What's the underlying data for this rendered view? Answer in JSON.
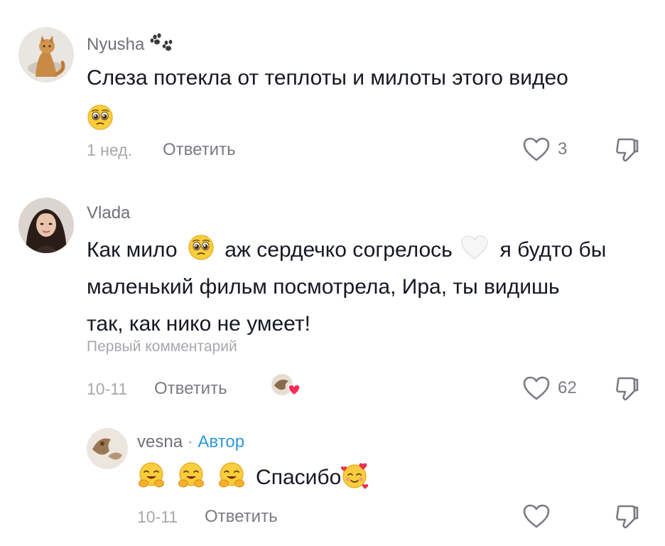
{
  "comments": [
    {
      "username": "Nyusha",
      "username_icon": "paw-prints-icon",
      "text_lines": [
        "Слеза потекла от теплоты и милоты этого видео"
      ],
      "emoji_after": "pleading-face-icon",
      "time": "1 нед.",
      "reply_label": "Ответить",
      "likes": "3"
    },
    {
      "username": "Vlada",
      "text_parts": {
        "a": "Как мило",
        "b": "аж сердечко согрелось",
        "c": "я будто бы"
      },
      "text_lines": [
        "маленький фильм посмотрела, Ира, ты видишь",
        "так, как нико не умеет!"
      ],
      "first_label": "Первый комментарий",
      "time": "10-11",
      "reply_label": "Ответить",
      "likes": "62"
    },
    {
      "username": "vesna",
      "separator": "·",
      "author_tag": "Автор",
      "text": "Спасибо",
      "time": "10-11",
      "reply_label": "Ответить",
      "likes": ""
    }
  ],
  "colors": {
    "text": "#161823",
    "secondary": "#7a7b82",
    "muted": "#a7a8ad",
    "author": "#2f9ad6",
    "heart_badge": "#fe2c55"
  }
}
